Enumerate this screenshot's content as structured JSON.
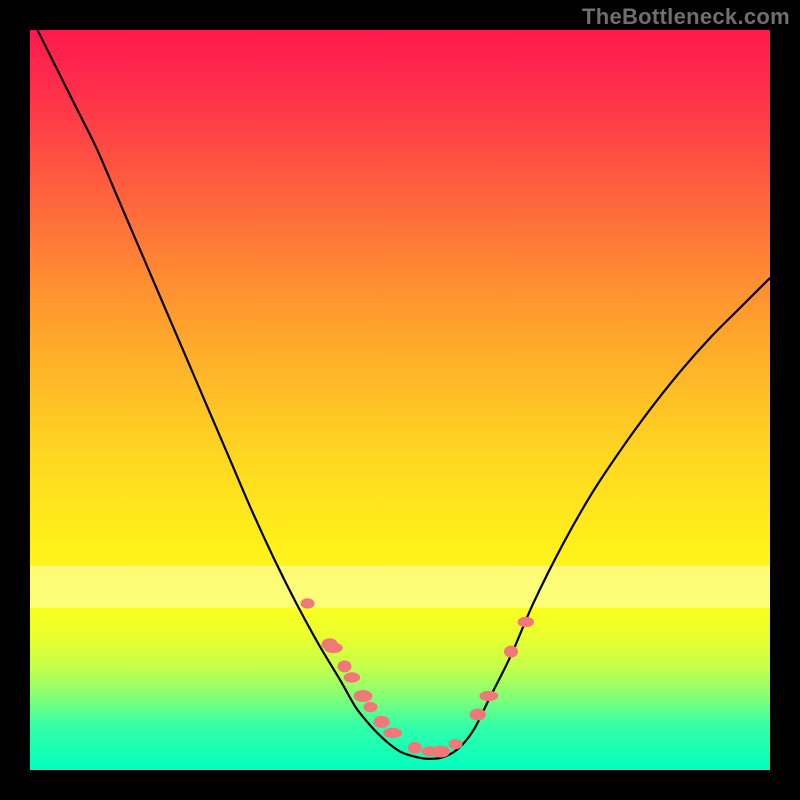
{
  "watermark": "TheBottleneck.com",
  "colors": {
    "curve_stroke": "#000000",
    "marker_fill": "#f07878",
    "marker_stroke": "#d65858"
  },
  "chart_data": {
    "type": "line",
    "title": "",
    "xlabel": "",
    "ylabel": "",
    "xlim": [
      0,
      1
    ],
    "ylim": [
      0,
      1
    ],
    "grid": false,
    "series": [
      {
        "name": "bottleneck-curve",
        "x": [
          0.0,
          0.03,
          0.06,
          0.09,
          0.12,
          0.15,
          0.18,
          0.21,
          0.24,
          0.27,
          0.3,
          0.33,
          0.36,
          0.39,
          0.42,
          0.44,
          0.46,
          0.48,
          0.5,
          0.52,
          0.54,
          0.56,
          0.58,
          0.6,
          0.62,
          0.65,
          0.68,
          0.72,
          0.76,
          0.8,
          0.84,
          0.88,
          0.92,
          0.96,
          1.0
        ],
        "y": [
          1.02,
          0.96,
          0.9,
          0.84,
          0.77,
          0.7,
          0.63,
          0.56,
          0.49,
          0.42,
          0.35,
          0.285,
          0.225,
          0.17,
          0.12,
          0.085,
          0.06,
          0.04,
          0.025,
          0.018,
          0.015,
          0.018,
          0.03,
          0.055,
          0.095,
          0.155,
          0.225,
          0.305,
          0.375,
          0.435,
          0.49,
          0.54,
          0.585,
          0.625,
          0.665
        ]
      }
    ],
    "markers": {
      "name": "highlighted-points",
      "x": [
        0.375,
        0.405,
        0.41,
        0.425,
        0.435,
        0.45,
        0.46,
        0.475,
        0.49,
        0.52,
        0.54,
        0.555,
        0.575,
        0.605,
        0.62,
        0.65,
        0.67
      ],
      "y": [
        0.225,
        0.17,
        0.165,
        0.14,
        0.125,
        0.1,
        0.085,
        0.065,
        0.05,
        0.03,
        0.025,
        0.025,
        0.035,
        0.075,
        0.1,
        0.16,
        0.2
      ]
    }
  }
}
